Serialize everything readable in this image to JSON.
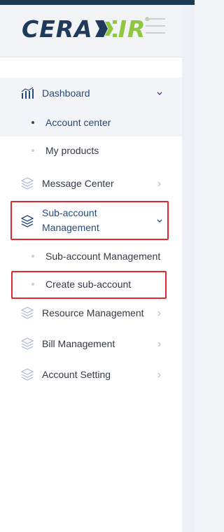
{
  "logo": {
    "text_left": "CERA",
    "text_right": "IR",
    "reg": "®"
  },
  "menu": {
    "dashboard": {
      "label": "Dashboard",
      "icon": "bar-chart-icon"
    },
    "account_center": {
      "label": "Account center"
    },
    "my_products": {
      "label": "My products"
    },
    "message_center": {
      "label": "Message Center",
      "icon": "layers-icon"
    },
    "sub_account_management": {
      "label_line1": "Sub-account",
      "label_line2": "Management",
      "icon": "layers-icon"
    },
    "sub_account_management_item": {
      "label": "Sub-account Management"
    },
    "create_sub_account": {
      "label": "Create sub-account"
    },
    "resource_management": {
      "label": "Resource Management",
      "icon": "layers-icon"
    },
    "bill_management": {
      "label": "Bill Management",
      "icon": "layers-icon"
    },
    "account_setting": {
      "label": "Account Setting",
      "icon": "layers-icon"
    }
  },
  "colors": {
    "brand_navy": "#1f3a5a",
    "brand_green": "#8fc740",
    "highlight_red": "#e0282e",
    "active_text": "#264a7a"
  }
}
